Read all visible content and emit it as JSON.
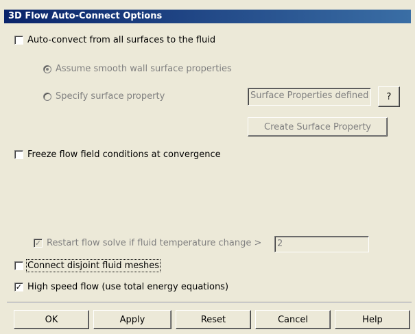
{
  "title": "3D Flow Auto-Connect Options",
  "options": {
    "auto_convect_label": "Auto-convect from all surfaces to the fluid",
    "assume_smooth_label": "Assume smooth wall surface properties",
    "specify_surface_label": "Specify surface property",
    "surface_field_value": "Surface Properties defined",
    "help_question_label": "?",
    "create_surface_label": "Create Surface Property",
    "freeze_label": "Freeze flow field conditions at convergence",
    "restart_label": "Restart flow solve if fluid temperature change >",
    "restart_value": "2",
    "connect_disjoint_label": "Connect disjoint fluid meshes",
    "high_speed_label": "High speed flow (use total energy equations)",
    "check_mark": "✓"
  },
  "buttons": {
    "ok": "OK",
    "apply": "Apply",
    "reset": "Reset",
    "cancel": "Cancel",
    "help": "Help"
  }
}
